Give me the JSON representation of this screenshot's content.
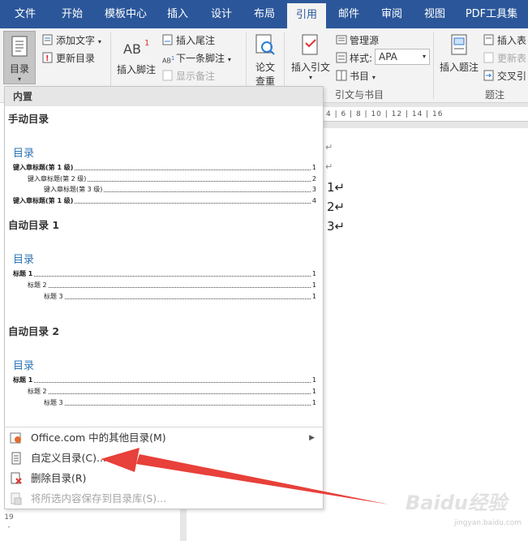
{
  "tabs": [
    {
      "label": "文件",
      "active": false
    },
    {
      "label": "开始",
      "active": false
    },
    {
      "label": "模板中心",
      "active": false
    },
    {
      "label": "插入",
      "active": false
    },
    {
      "label": "设计",
      "active": false
    },
    {
      "label": "布局",
      "active": false
    },
    {
      "label": "引用",
      "active": true
    },
    {
      "label": "邮件",
      "active": false
    },
    {
      "label": "审阅",
      "active": false
    },
    {
      "label": "视图",
      "active": false
    },
    {
      "label": "PDF工具集",
      "active": false
    }
  ],
  "ribbon": {
    "toc_button": "目录",
    "add_text": "添加文字",
    "update_toc": "更新目录",
    "insert_footnote": "插入脚注",
    "insert_endnote": "插入尾注",
    "next_footnote": "下一条脚注",
    "show_notes": "显示备注",
    "paper_check_line1": "论文",
    "paper_check_line2": "查重",
    "insert_citation": "插入引文",
    "manage_sources": "管理源",
    "style_label": "样式:",
    "style_value": "APA",
    "bibliography": "书目",
    "group_citations": "引文与书目",
    "insert_caption": "插入题注",
    "insert_table": "插入表",
    "update_table": "更新表",
    "cross_ref": "交叉引",
    "group_captions": "题注",
    "ab_glyph": "AB",
    "ab_sup": "1"
  },
  "ruler_text": "4 | 6 | 8 | 10 | 12 | 14 | 16",
  "vruler_text": "1 - 19 -",
  "document": {
    "lines": [
      "↵",
      "↵",
      "1↵",
      "2↵",
      "3↵"
    ]
  },
  "dropdown": {
    "header": "内置",
    "manual_toc": {
      "heading": "手动目录",
      "title": "目录",
      "lines": [
        {
          "text": "键入章标题(第 1 级)",
          "page": "1"
        },
        {
          "text": "键入章标题(第 2 级)",
          "page": "2"
        },
        {
          "text": "键入章标题(第 3 级)",
          "page": "3"
        },
        {
          "text": "键入章标题(第 1 级)",
          "page": "4"
        }
      ]
    },
    "auto_toc_1": {
      "heading": "自动目录 1",
      "title": "目录",
      "lines": [
        {
          "text": "标题 1",
          "page": "1"
        },
        {
          "text": "标题 2",
          "page": "1"
        },
        {
          "text": "标题 3",
          "page": "1"
        }
      ]
    },
    "auto_toc_2": {
      "heading": "自动目录 2",
      "title": "目录",
      "lines": [
        {
          "text": "标题 1",
          "page": "1"
        },
        {
          "text": "标题 2",
          "page": "1"
        },
        {
          "text": "标题 3",
          "page": "1"
        }
      ]
    },
    "menu": {
      "office_more": "Office.com 中的其他目录(M)",
      "custom_toc": "自定义目录(C)...",
      "remove_toc": "删除目录(R)",
      "save_selection": "将所选内容保存到目录库(S)..."
    }
  },
  "watermark": "Baidu经验",
  "watermark_url": "jingyan.baidu.com",
  "colors": {
    "accent": "#2b579a",
    "toc_title": "#2e74b5",
    "arrow": "#e8403a"
  }
}
